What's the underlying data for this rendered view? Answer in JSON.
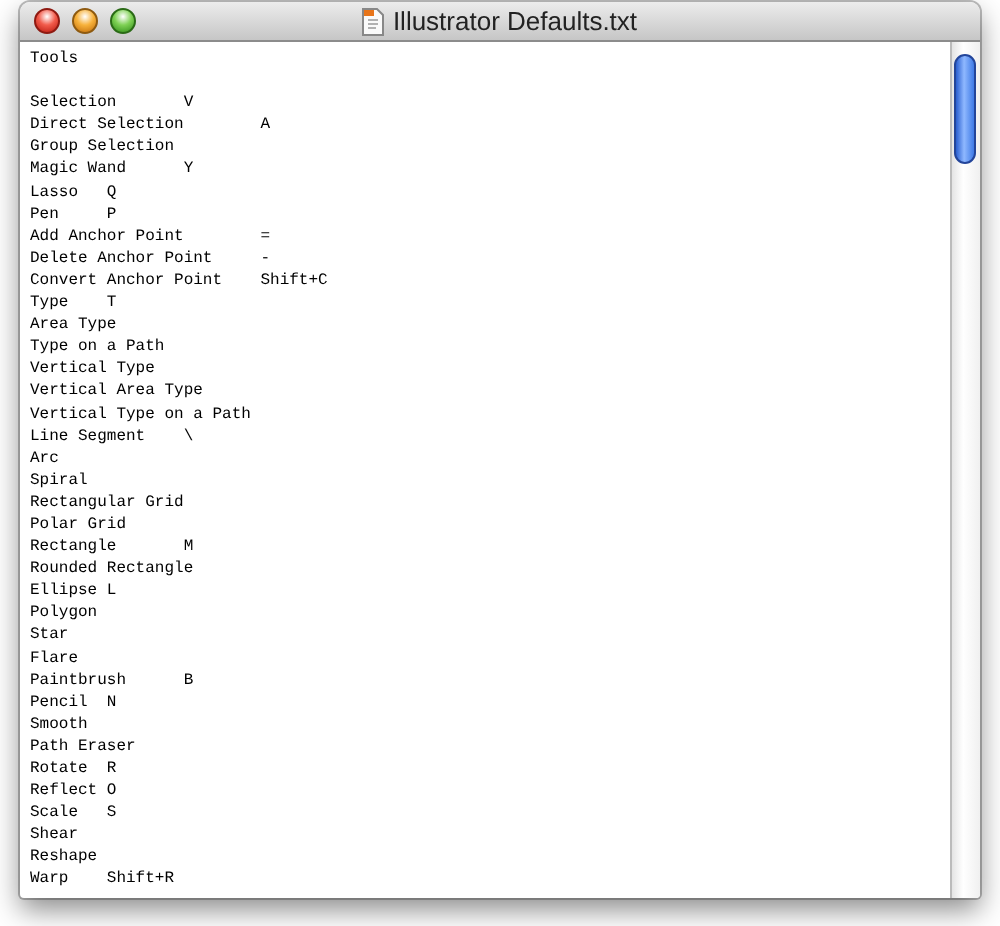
{
  "window": {
    "title": "Illustrator Defaults.txt"
  },
  "document": {
    "heading": "Tools",
    "lines": [
      {
        "name": "Selection",
        "key": "V"
      },
      {
        "name": "Direct Selection",
        "key": "A"
      },
      {
        "name": "Group Selection"
      },
      {
        "name": "Magic Wand",
        "key": "Y"
      },
      {
        "name": "Lasso",
        "key": "Q"
      },
      {
        "name": "Pen",
        "key": "P"
      },
      {
        "name": "Add Anchor Point",
        "key": "="
      },
      {
        "name": "Delete Anchor Point",
        "key": "-"
      },
      {
        "name": "Convert Anchor Point",
        "key": "Shift+C"
      },
      {
        "name": "Type",
        "key": "T"
      },
      {
        "name": "Area Type"
      },
      {
        "name": "Type on a Path"
      },
      {
        "name": "Vertical Type"
      },
      {
        "name": "Vertical Area Type"
      },
      {
        "name": "Vertical Type on a Path"
      },
      {
        "name": "Line Segment",
        "key": "\\"
      },
      {
        "name": "Arc"
      },
      {
        "name": "Spiral"
      },
      {
        "name": "Rectangular Grid"
      },
      {
        "name": "Polar Grid"
      },
      {
        "name": "Rectangle",
        "key": "M"
      },
      {
        "name": "Rounded Rectangle"
      },
      {
        "name": "Ellipse",
        "key": "L"
      },
      {
        "name": "Polygon"
      },
      {
        "name": "Star"
      },
      {
        "name": "Flare"
      },
      {
        "name": "Paintbrush",
        "key": "B"
      },
      {
        "name": "Pencil",
        "key": "N"
      },
      {
        "name": "Smooth"
      },
      {
        "name": "Path Eraser"
      },
      {
        "name": "Rotate",
        "key": "R"
      },
      {
        "name": "Reflect",
        "key": "O"
      },
      {
        "name": "Scale",
        "key": "S"
      },
      {
        "name": "Shear"
      },
      {
        "name": "Reshape"
      },
      {
        "name": "Warp",
        "key": "Shift+R"
      }
    ]
  }
}
